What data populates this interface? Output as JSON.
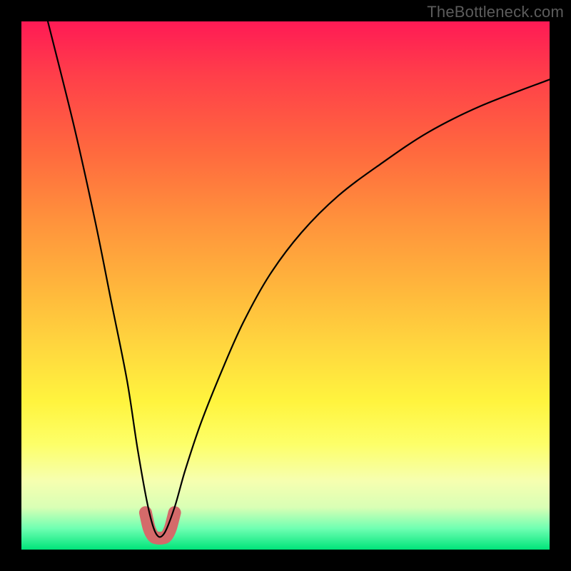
{
  "watermark": "TheBottleneck.com",
  "chart_data": {
    "type": "line",
    "title": "",
    "xlabel": "",
    "ylabel": "",
    "xlim": [
      0,
      100
    ],
    "ylim": [
      0,
      100
    ],
    "grid": false,
    "legend": false,
    "background_gradient": [
      {
        "pos": 0,
        "color": "#ff1a55"
      },
      {
        "pos": 50,
        "color": "#ffb53c"
      },
      {
        "pos": 80,
        "color": "#fdff68"
      },
      {
        "pos": 100,
        "color": "#00e47a"
      }
    ],
    "series": [
      {
        "name": "bottleneck-curve",
        "color": "#000000",
        "x": [
          5,
          10,
          14,
          17,
          20,
          22,
          24,
          25.5,
          27,
          29,
          31,
          34,
          38,
          42,
          47,
          53,
          60,
          68,
          77,
          87,
          100
        ],
        "values": [
          100,
          80,
          62,
          47,
          32,
          19,
          8,
          3,
          3,
          8,
          15,
          24,
          34,
          43,
          52,
          60,
          67,
          73,
          79,
          84,
          89
        ]
      },
      {
        "name": "bottleneck-trough-marker",
        "color": "#d46a6a",
        "x": [
          23.5,
          24.2,
          25.0,
          25.8,
          26.6,
          27.4,
          28.2,
          29.0
        ],
        "values": [
          7.0,
          4.0,
          2.5,
          2.2,
          2.2,
          2.5,
          4.0,
          7.0
        ]
      }
    ]
  }
}
